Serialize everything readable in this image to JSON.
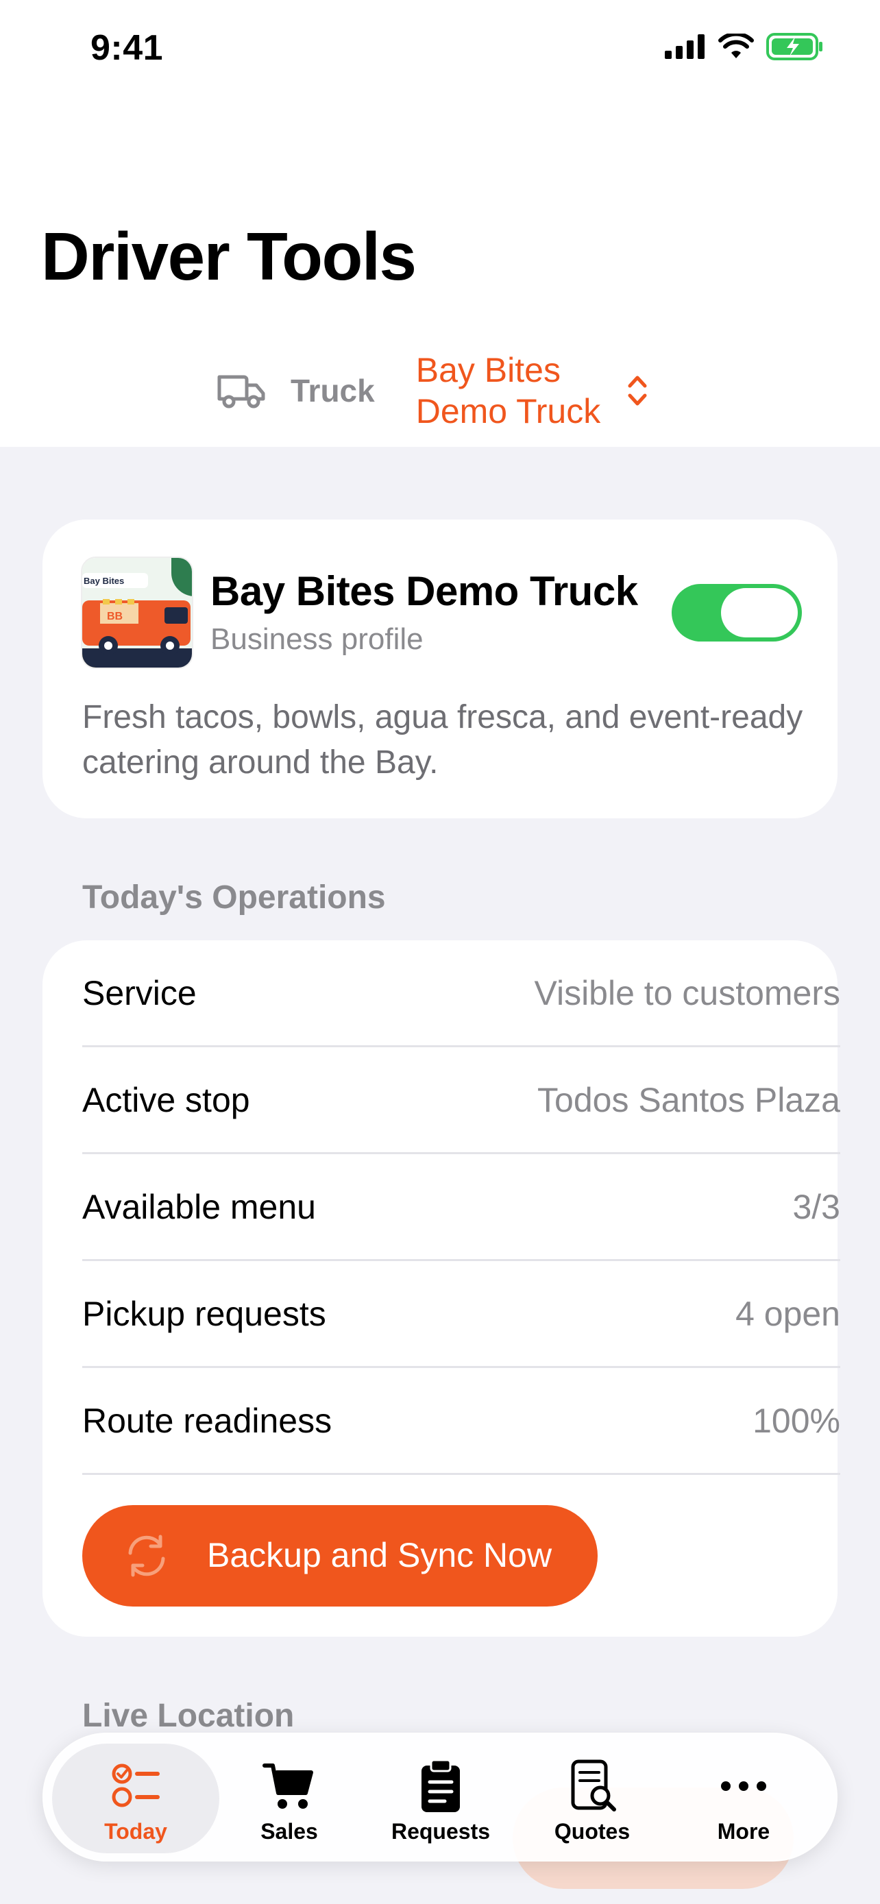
{
  "status_bar": {
    "time": "9:41"
  },
  "page_title": "Driver Tools",
  "truck_selector": {
    "label": "Truck",
    "value": "Bay Bites Demo Truck"
  },
  "profile": {
    "name": "Bay Bites Demo Truck",
    "subtitle": "Business profile",
    "description": "Fresh tacos, bowls, agua fresca, and event-ready catering around the Bay.",
    "logo_text": "Bay Bites",
    "logo_badge": "BB",
    "enabled": true
  },
  "operations": {
    "header": "Today's Operations",
    "rows": [
      {
        "label": "Service",
        "value": "Visible to customers"
      },
      {
        "label": "Active stop",
        "value": "Todos Santos Plaza"
      },
      {
        "label": "Available menu",
        "value": "3/3"
      },
      {
        "label": "Pickup requests",
        "value": "4 open"
      },
      {
        "label": "Route readiness",
        "value": "100%"
      }
    ],
    "sync_button": "Backup and Sync Now"
  },
  "live_location": {
    "header": "Live Location"
  },
  "tab_bar": {
    "items": [
      {
        "label": "Today",
        "icon": "checklist-icon",
        "active": true
      },
      {
        "label": "Sales",
        "icon": "cart-icon",
        "active": false
      },
      {
        "label": "Requests",
        "icon": "clipboard-icon",
        "active": false
      },
      {
        "label": "Quotes",
        "icon": "document-search-icon",
        "active": false
      },
      {
        "label": "More",
        "icon": "ellipsis-icon",
        "active": false
      }
    ]
  },
  "colors": {
    "accent": "#f0561d",
    "toggle_on": "#34c759",
    "background": "#f2f2f7",
    "secondary_text": "#8a8a8e"
  }
}
